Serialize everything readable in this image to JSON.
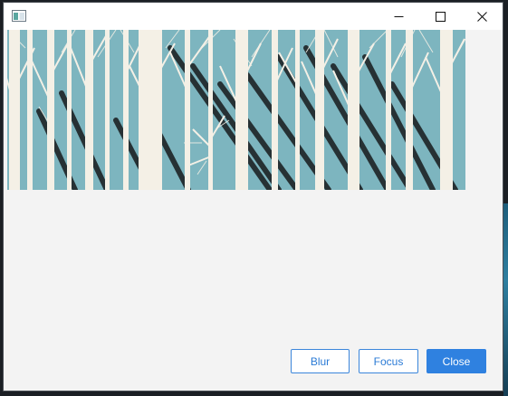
{
  "window": {
    "title": "",
    "icon": "app-window-icon",
    "caption_buttons": [
      {
        "name": "minimize",
        "icon": "minimize-icon"
      },
      {
        "name": "maximize",
        "icon": "maximize-icon"
      },
      {
        "name": "close",
        "icon": "close-icon"
      }
    ]
  },
  "image": {
    "description_icon": "forest-birch-trees-image",
    "colors": {
      "sky": "#7db5bf",
      "trunks": "#f4f0e6",
      "shadows": "#1d2326"
    }
  },
  "actions": {
    "blur_label": "Blur",
    "focus_label": "Focus",
    "close_label": "Close"
  },
  "colors": {
    "accent": "#2f81e0",
    "window_bg": "#f3f3f3",
    "titlebar_bg": "#ffffff"
  }
}
